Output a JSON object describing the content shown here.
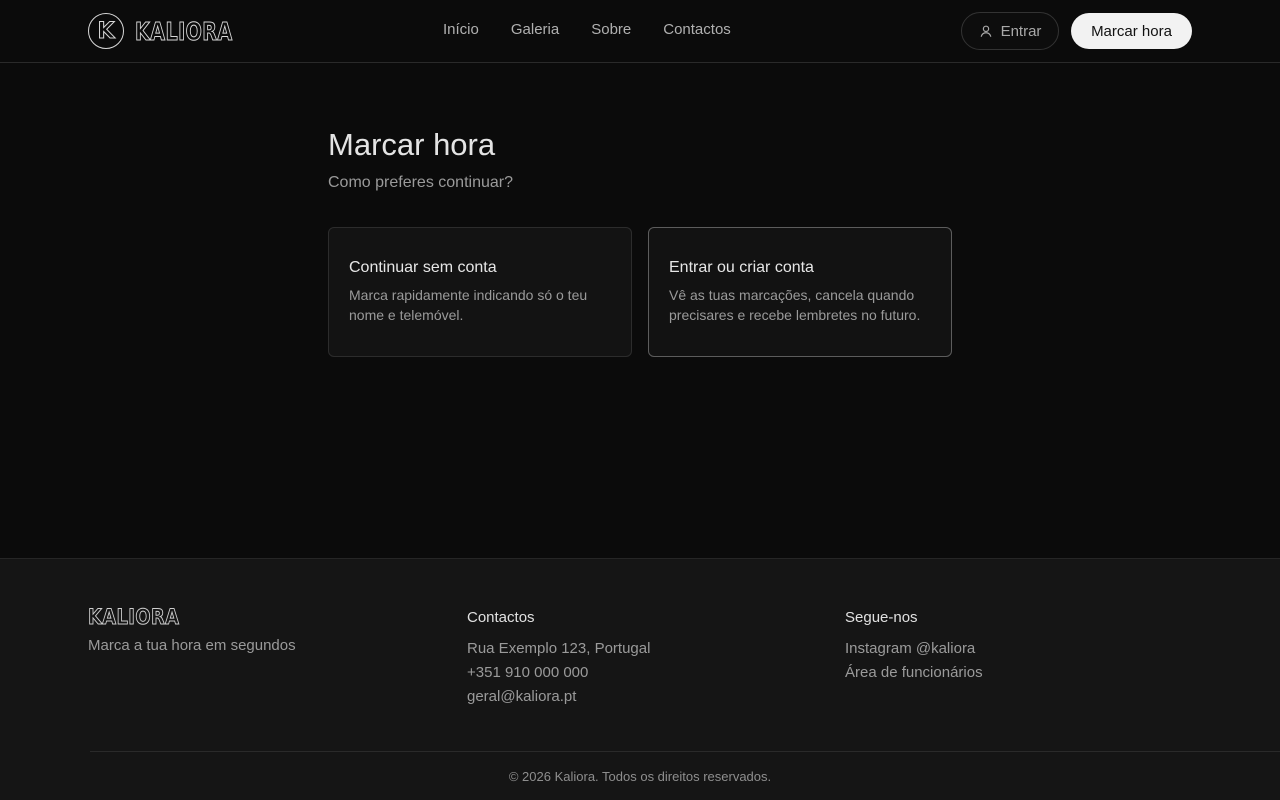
{
  "header": {
    "brand": "KALIORA",
    "logo_letter": "K",
    "nav": [
      "Início",
      "Galeria",
      "Sobre",
      "Contactos"
    ],
    "login_label": "Entrar",
    "login_icon": "user-icon",
    "book_label": "Marcar hora"
  },
  "main": {
    "title": "Marcar hora",
    "subtitle": "Como preferes continuar?",
    "options": [
      {
        "title": "Continuar sem conta",
        "description": "Marca rapidamente indicando só o teu nome e telemóvel."
      },
      {
        "title": "Entrar ou criar conta",
        "description": "Vê as tuas marcações, cancela quando precisares e recebe lembretes no futuro."
      }
    ]
  },
  "footer": {
    "brand": "KALIORA",
    "tagline": "Marca a tua hora em segundos",
    "contacts": {
      "title": "Contactos",
      "address": "Rua Exemplo 123, Portugal",
      "phone": "+351 910 000 000",
      "email": "geral@kaliora.pt"
    },
    "social": {
      "title": "Segue-nos",
      "instagram": "Instagram @kaliora",
      "staff": "Área de funcionários"
    },
    "copyright": "© 2026 Kaliora. Todos os direitos reservados."
  },
  "colors": {
    "background": "#0b0b0b",
    "footer_background": "#151515",
    "primary_button": "#f2f2f2"
  }
}
